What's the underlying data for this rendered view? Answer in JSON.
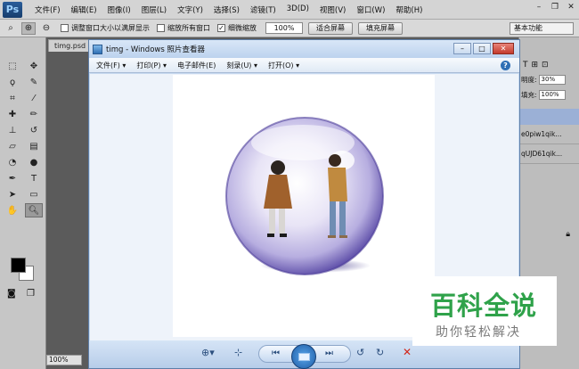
{
  "ps": {
    "logo": "Ps",
    "menu": [
      "文件(F)",
      "编辑(E)",
      "图像(I)",
      "图层(L)",
      "文字(Y)",
      "选择(S)",
      "滤镜(T)",
      "3D(D)",
      "视图(V)",
      "窗口(W)",
      "帮助(H)"
    ],
    "options": {
      "resize_windows": "调整窗口大小以满屏显示",
      "zoom_all": "缩放所有窗口",
      "scrubby_zoom": "细微缩放",
      "zoom_value": "100%",
      "fit_screen": "适合屏幕",
      "fill_screen": "填充屏幕",
      "workspace": "基本功能"
    },
    "doc_tab": "timg.psd @",
    "zoom_level": "100%",
    "panels": {
      "opacity_label": "明度:",
      "opacity_value": "30%",
      "fill_label": "填充:",
      "fill_value": "100%",
      "layers": [
        "e0piw1qik...",
        "qUJD61qik..."
      ]
    }
  },
  "viewer": {
    "title": "timg - Windows 照片查看器",
    "menu": [
      "文件(F) ▾",
      "打印(P) ▾",
      "电子邮件(E)",
      "刻录(U) ▾",
      "打开(O) ▾"
    ],
    "help": "?"
  },
  "watermark": {
    "title": "百科全说",
    "subtitle": "助你轻松解决"
  }
}
